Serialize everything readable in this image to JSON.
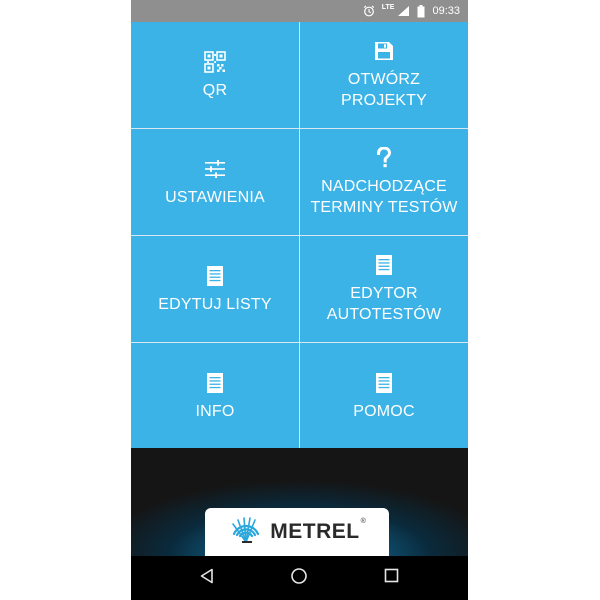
{
  "status_bar": {
    "network": "LTE",
    "time": "09:33",
    "icons": [
      "alarm-icon",
      "signal-icon",
      "battery-icon"
    ]
  },
  "menu": {
    "tiles": [
      {
        "id": "qr",
        "label": "QR",
        "icon": "qr-code-icon"
      },
      {
        "id": "open-projects",
        "label": "OTWÓRZ\nPROJEKTY",
        "icon": "floppy-disk-icon"
      },
      {
        "id": "settings",
        "label": "USTAWIENIA",
        "icon": "sliders-icon"
      },
      {
        "id": "upcoming-tests",
        "label": "NADCHODZĄCE\nTERMINY TESTÓW",
        "icon": "question-mark-icon"
      },
      {
        "id": "edit-lists",
        "label": "EDYTUJ LISTY",
        "icon": "document-icon"
      },
      {
        "id": "autotest-editor",
        "label": "EDYTOR\nAUTOTESTÓW",
        "icon": "document-icon"
      },
      {
        "id": "info",
        "label": "INFO",
        "icon": "document-icon"
      },
      {
        "id": "help",
        "label": "POMOC",
        "icon": "document-icon"
      }
    ]
  },
  "branding": {
    "logo_text": "METREL",
    "registered_mark": "®"
  },
  "nav_bar": {
    "icons": [
      "back-icon",
      "home-icon",
      "recents-icon"
    ]
  },
  "colors": {
    "tile": "#3cb3e6",
    "tile_text": "#ffffff",
    "status_bar": "#8f8f8f",
    "nav_bar": "#000000"
  }
}
